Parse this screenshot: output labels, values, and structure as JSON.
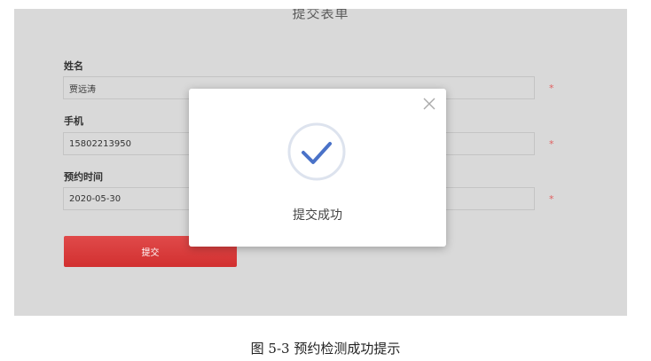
{
  "form": {
    "title": "提交表单",
    "fields": [
      {
        "label": "姓名",
        "value": "贾远涛",
        "required_mark": "*"
      },
      {
        "label": "手机",
        "value": "15802213950",
        "required_mark": "*"
      },
      {
        "label": "预约时间",
        "value": "2020-05-30",
        "required_mark": "*"
      }
    ],
    "submit_label": "提交"
  },
  "modal": {
    "message": "提交成功",
    "icon": "check-circle-icon",
    "close_icon": "close-icon"
  },
  "caption": "图 5-3 预约检测成功提示",
  "colors": {
    "submit": "#d83535",
    "check": "#4a72c8",
    "screen_bg": "#d9d9d9"
  }
}
